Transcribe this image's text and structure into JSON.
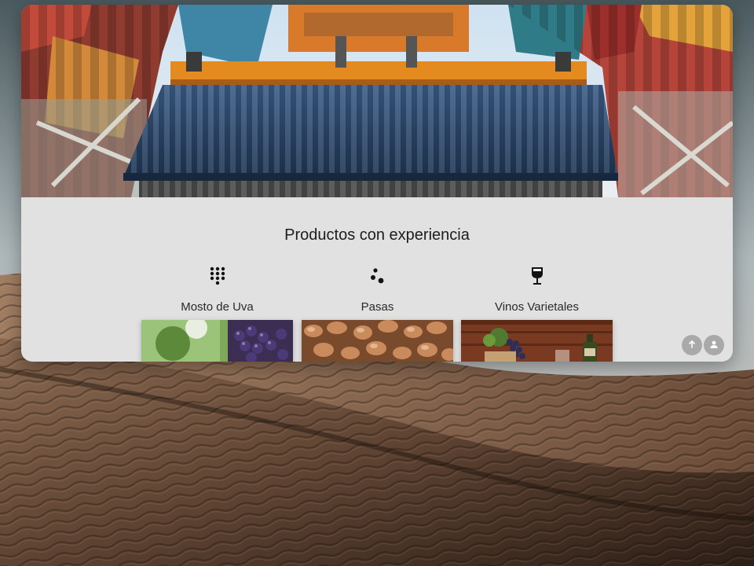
{
  "section": {
    "title": "Productos con experiencia"
  },
  "products": [
    {
      "label": "Mosto de Uva",
      "icon": "dot-grid-icon"
    },
    {
      "label": "Pasas",
      "icon": "raisins-icon"
    },
    {
      "label": "Vinos Varietales",
      "icon": "wine-glass-icon"
    }
  ],
  "floating_buttons": [
    {
      "name": "scroll-to-top-button",
      "icon": "arrow-up-icon"
    },
    {
      "name": "user-account-button",
      "icon": "person-icon"
    }
  ],
  "colors": {
    "window_background": "#e1e1e1",
    "container_blue": "#2f4a6e",
    "crane_orange": "#e58a1f",
    "button_gray": "#a9a9a9"
  }
}
